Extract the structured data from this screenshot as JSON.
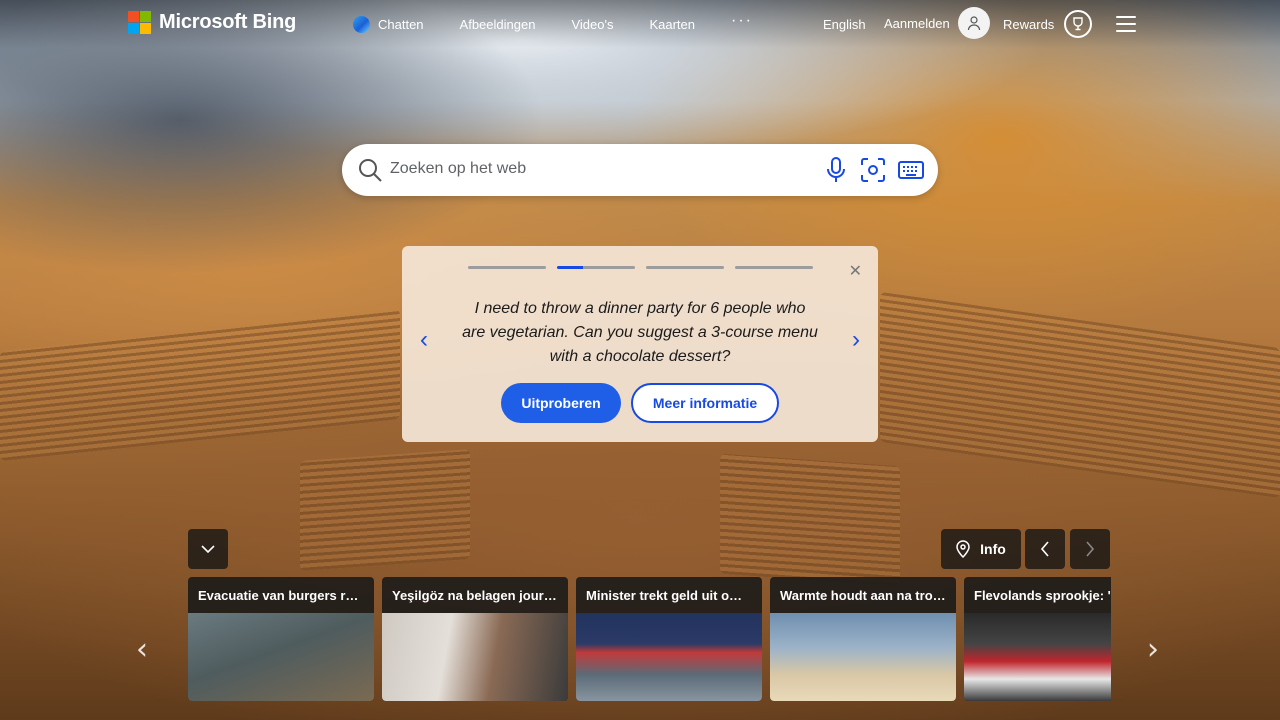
{
  "brand": {
    "logo_text": "Microsoft Bing"
  },
  "nav": [
    {
      "label": "Chatten",
      "icon": "copilot-icon"
    },
    {
      "label": "Afbeeldingen"
    },
    {
      "label": "Video's"
    },
    {
      "label": "Kaarten"
    },
    {
      "label": "···",
      "icon": "more-icon"
    }
  ],
  "header_right": {
    "language": "English",
    "signin": "Aanmelden",
    "rewards": "Rewards"
  },
  "search": {
    "placeholder": "Zoeken op het web",
    "tools": [
      "microphone-icon",
      "visual-search-icon",
      "keyboard-icon"
    ]
  },
  "suggestion_card": {
    "active_index": 1,
    "total": 4,
    "text": "I need to throw a dinner party for 6 people who are vegetarian. Can you suggest a 3-course menu with a chocolate dessert?",
    "primary_button": "Uitproberen",
    "secondary_button": "Meer informatie"
  },
  "image_controls": {
    "info_label": "Info"
  },
  "news": [
    {
      "title": "Evacuatie van burgers ron...",
      "thumb_colors": [
        "#5b6a6e",
        "#7a6a52"
      ]
    },
    {
      "title": "Yeşilgöz na belagen journa...",
      "thumb_colors": [
        "#d9d4cf",
        "#8a6a55"
      ]
    },
    {
      "title": "Minister trekt geld uit om t...",
      "thumb_colors": [
        "#2b3a66",
        "#c23a3a"
      ]
    },
    {
      "title": "Warmte houdt aan na tropi...",
      "thumb_colors": [
        "#6f8fb0",
        "#d9c8a6"
      ]
    },
    {
      "title": "Flevolands sprookje: 'lekk...",
      "thumb_colors": [
        "#2a2a2a",
        "#c0262d"
      ]
    }
  ],
  "colors": {
    "accent": "#174ae4",
    "primary_button": "#1f5ee6"
  }
}
